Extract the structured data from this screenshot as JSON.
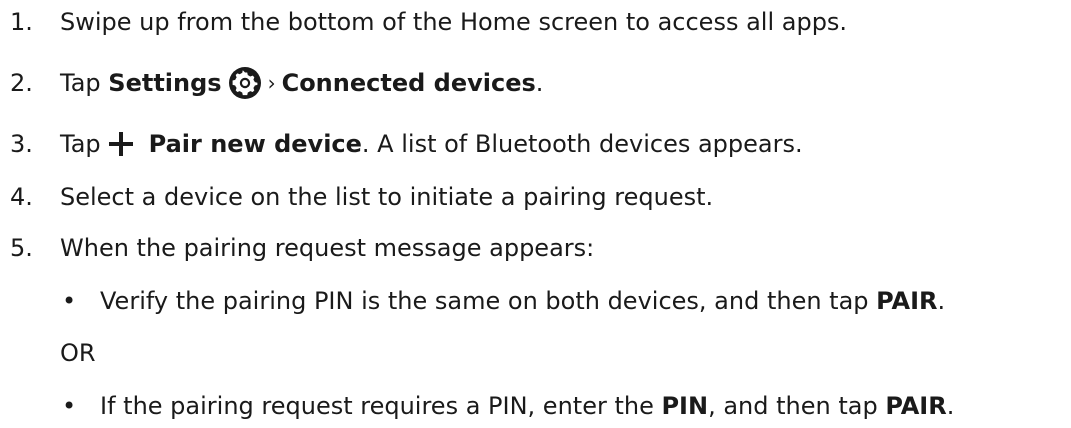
{
  "steps": [
    {
      "num": "1.",
      "text": "Swipe up from the bottom of the Home screen to access all apps."
    },
    {
      "num": "2.",
      "tap": "Tap",
      "settings": "Settings",
      "sep": "›",
      "connected": "Connected devices",
      "end": "."
    },
    {
      "num": "3.",
      "tap": "Tap",
      "pair": "Pair new device",
      "rest": ". A list of Bluetooth devices appears."
    },
    {
      "num": "4.",
      "text": "Select a device on the list to initiate a pairing request."
    },
    {
      "num": "5.",
      "text": "When the pairing request message appears:"
    }
  ],
  "bullets": [
    {
      "bullet": "•",
      "pre": "Verify the pairing PIN is the same on both devices, and then tap ",
      "bold": "PAIR",
      "end": "."
    },
    {
      "bullet": "•",
      "pre": "If the pairing request requires a PIN, enter the ",
      "bold1": "PIN",
      "mid": ", and then tap ",
      "bold2": "PAIR",
      "end": "."
    }
  ],
  "or_text": "OR",
  "icons": {
    "settings": "gear-icon",
    "add": "plus-icon"
  },
  "colors": {
    "text": "#1a1a1a",
    "icon": "#1a1a1a"
  }
}
